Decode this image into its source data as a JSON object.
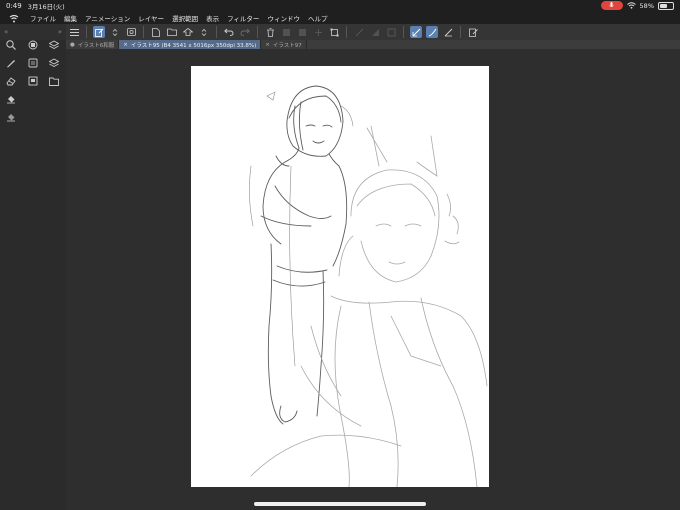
{
  "status": {
    "time": "0:49",
    "date": "3月16日(火)",
    "battery": "58%",
    "battery_level": 0.58
  },
  "menu": {
    "items": [
      "ファイル",
      "編集",
      "アニメーション",
      "レイヤー",
      "選択範囲",
      "表示",
      "フィルター",
      "ウィンドウ",
      "ヘルプ"
    ]
  },
  "left_header": {
    "chevrons_left": "«",
    "chevrons_right": "»"
  },
  "tabs": [
    {
      "label": "イラスト6和服",
      "active": false,
      "mark": "●"
    },
    {
      "label": "イラスト95 (B4 3541 x 5016px 350dpi 33.8%)",
      "active": true,
      "mark": "×"
    },
    {
      "label": "イラスト97",
      "active": false,
      "mark": "×"
    }
  ],
  "icons": {
    "logo": "clip-studio-logo-icon",
    "mic": "microphone-icon",
    "wifi": "wifi-icon",
    "battery": "battery-icon"
  },
  "colors": {
    "accent": "#5a7fb0",
    "active_tab": "#566a8a",
    "mic": "#e0463d",
    "sketch": "#7a7a7a"
  }
}
